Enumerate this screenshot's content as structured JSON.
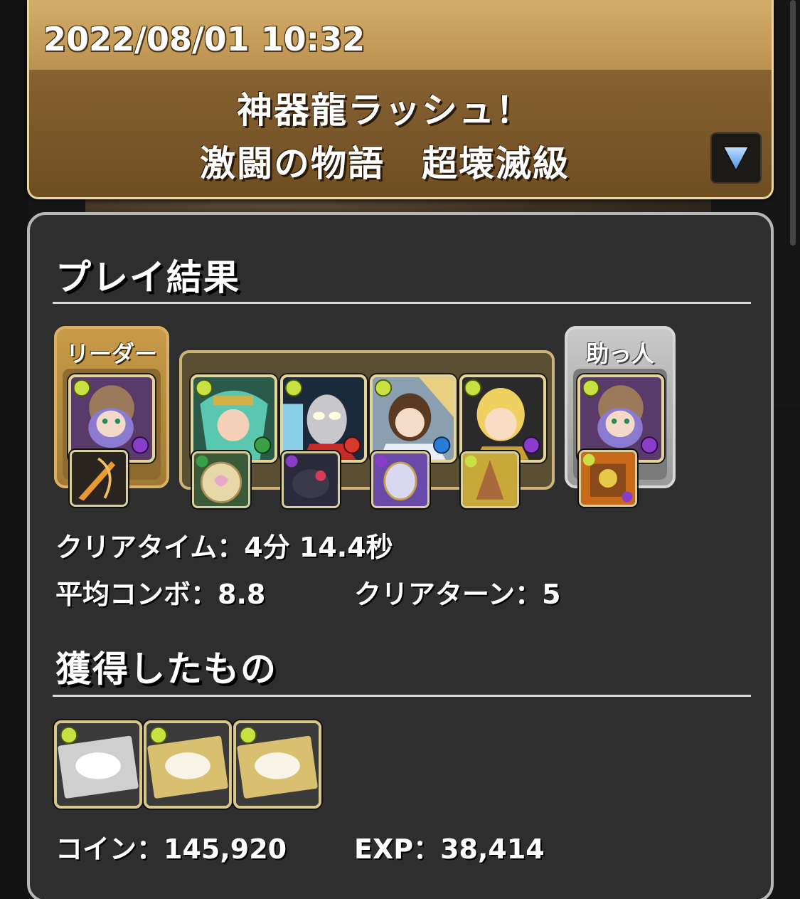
{
  "header": {
    "datetime": "2022/08/01 10:32",
    "dungeon_line1": "神器龍ラッシュ！",
    "dungeon_line2": "激闘の物語　超壊滅級"
  },
  "result": {
    "section_title": "プレイ結果",
    "leader_label": "リーダー",
    "helper_label": "助っ人",
    "team": [
      {
        "name": "leader",
        "attribute_color": "#c8e040",
        "sub_color": "#8a3ec8"
      },
      {
        "name": "sub-1",
        "attribute_color": "#c8e040",
        "sub_color": "#3aa048"
      },
      {
        "name": "sub-2",
        "attribute_color": "#c8e040",
        "sub_color": "#d83a2a"
      },
      {
        "name": "sub-3",
        "attribute_color": "#c8e040",
        "sub_color": "#2a7ad8"
      },
      {
        "name": "sub-4",
        "attribute_color": "#c8e040",
        "sub_color": "#8a3ec8"
      },
      {
        "name": "helper",
        "attribute_color": "#c8e040",
        "sub_color": "#8a3ec8"
      }
    ],
    "clear_time_label": "クリアタイム：",
    "clear_time_value": "4分 14.4秒",
    "avg_combo_label": "平均コンボ：",
    "avg_combo_value": "8.8",
    "clear_turn_label": "クリアターン：",
    "clear_turn_value": "5"
  },
  "obtained": {
    "section_title": "獲得したもの",
    "rewards": [
      {
        "name": "silver-dragon-ticket",
        "tone": "silver"
      },
      {
        "name": "gold-dragon-ticket",
        "tone": "gold"
      },
      {
        "name": "gold-dragon-ticket",
        "tone": "gold"
      }
    ],
    "coin_label": "コイン：",
    "coin_value": "145,920",
    "exp_label": "EXP：",
    "exp_value": "38,414"
  }
}
